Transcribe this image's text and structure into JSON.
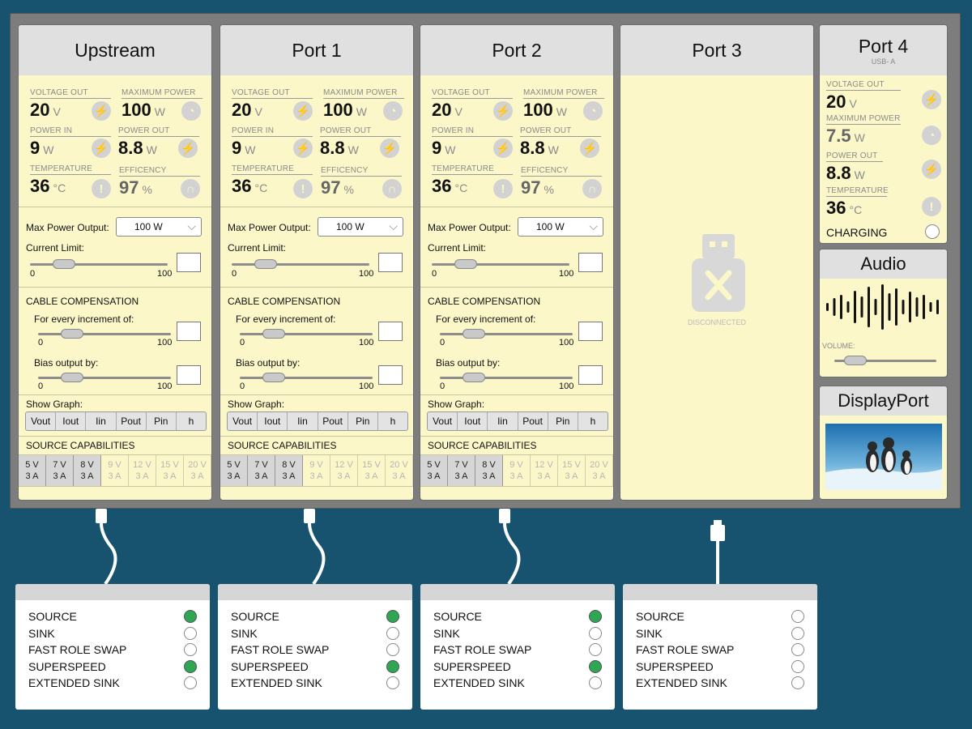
{
  "ports": [
    {
      "title": "Upstream"
    },
    {
      "title": "Port 1"
    },
    {
      "title": "Port 2"
    }
  ],
  "stats": {
    "voltage_out": {
      "label": "VOLTAGE OUT",
      "value": "20",
      "unit": "V"
    },
    "max_power": {
      "label": "MAXIMUM POWER",
      "value": "100",
      "unit": "W"
    },
    "power_in": {
      "label": "POWER IN",
      "value": "9",
      "unit": "W"
    },
    "power_out": {
      "label": "POWER OUT",
      "value": "8.8",
      "unit": "W"
    },
    "temperature": {
      "label": "TEMPERATURE",
      "value": "36",
      "unit": "°C"
    },
    "efficiency": {
      "label": "EFFICENCY",
      "value": "97",
      "unit": "%"
    }
  },
  "controls": {
    "max_power_label": "Max Power Output:",
    "max_power_value": "100 W",
    "current_limit_label": "Current Limit:",
    "range_min": "0",
    "range_max": "100",
    "cable_comp_title": "CABLE COMPENSATION",
    "increment_label": "For every increment of:",
    "bias_label": "Bias output by:",
    "show_graph_label": "Show Graph:",
    "graph_buttons": [
      "Vout",
      "Iout",
      "Iin",
      "Pout",
      "Pin",
      "h"
    ],
    "source_caps_title": "SOURCE CAPABILITIES"
  },
  "capabilities": [
    {
      "v": "5 V",
      "a": "3 A",
      "active": true
    },
    {
      "v": "7 V",
      "a": "3 A",
      "active": true
    },
    {
      "v": "8 V",
      "a": "3 A",
      "active": true
    },
    {
      "v": "9 V",
      "a": "3 A",
      "active": false
    },
    {
      "v": "12 V",
      "a": "3 A",
      "active": false
    },
    {
      "v": "15 V",
      "a": "3 A",
      "active": false
    },
    {
      "v": "20 V",
      "a": "3 A",
      "active": false
    }
  ],
  "port3": {
    "title": "Port 3",
    "status": "DISCONNECTED"
  },
  "port4": {
    "title": "Port 4",
    "subtitle": "USB- A",
    "voltage_label": "VOLTAGE OUT",
    "voltage_value": "20",
    "voltage_unit": "V",
    "max_power_label": "MAXIMUM POWER",
    "max_power_value": "7.5",
    "max_power_unit": "W",
    "power_out_label": "POWER OUT",
    "power_out_value": "8.8",
    "power_out_unit": "W",
    "temp_label": "TEMPERATURE",
    "temp_value": "36",
    "temp_unit": "°C",
    "charging_label": "CHARGING"
  },
  "audio": {
    "title": "Audio",
    "volume_label": "VOLUME:"
  },
  "displayport": {
    "title": "DisplayPort"
  },
  "device_cards": [
    {
      "rows": [
        {
          "label": "SOURCE",
          "on": true
        },
        {
          "label": "SINK",
          "on": false
        },
        {
          "label": "FAST ROLE SWAP",
          "on": false
        },
        {
          "label": "SUPERSPEED",
          "on": true
        },
        {
          "label": "EXTENDED SINK",
          "on": false
        }
      ]
    },
    {
      "rows": [
        {
          "label": "SOURCE",
          "on": true
        },
        {
          "label": "SINK",
          "on": false
        },
        {
          "label": "FAST ROLE SWAP",
          "on": false
        },
        {
          "label": "SUPERSPEED",
          "on": true
        },
        {
          "label": "EXTENDED SINK",
          "on": false
        }
      ]
    },
    {
      "rows": [
        {
          "label": "SOURCE",
          "on": true
        },
        {
          "label": "SINK",
          "on": false
        },
        {
          "label": "FAST ROLE SWAP",
          "on": false
        },
        {
          "label": "SUPERSPEED",
          "on": true
        },
        {
          "label": "EXTENDED SINK",
          "on": false
        }
      ]
    },
    {
      "rows": [
        {
          "label": "SOURCE",
          "on": false
        },
        {
          "label": "SINK",
          "on": false
        },
        {
          "label": "FAST ROLE SWAP",
          "on": false
        },
        {
          "label": "SUPERSPEED",
          "on": false
        },
        {
          "label": "EXTENDED SINK",
          "on": false
        }
      ]
    }
  ]
}
